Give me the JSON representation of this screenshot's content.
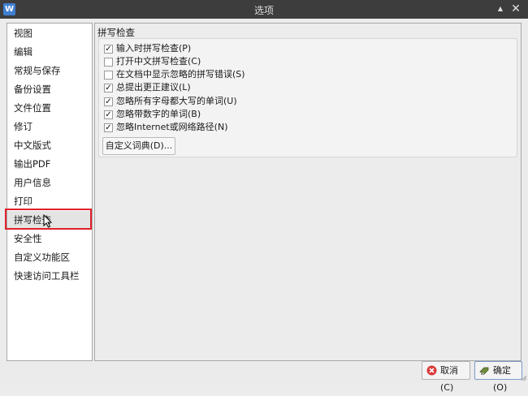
{
  "window": {
    "title": "选项",
    "app_icon_letter": "W"
  },
  "nav": {
    "items": [
      {
        "label": "视图"
      },
      {
        "label": "编辑"
      },
      {
        "label": "常规与保存"
      },
      {
        "label": "备份设置"
      },
      {
        "label": "文件位置"
      },
      {
        "label": "修订"
      },
      {
        "label": "中文版式"
      },
      {
        "label": "输出PDF"
      },
      {
        "label": "用户信息"
      },
      {
        "label": "打印"
      },
      {
        "label": "拼写检查"
      },
      {
        "label": "安全性"
      },
      {
        "label": "自定义功能区"
      },
      {
        "label": "快速访问工具栏"
      }
    ],
    "selected": "拼写检查"
  },
  "panel": {
    "section_title": "拼写检查",
    "options": [
      {
        "label": "输入时拼写检查(P)",
        "checked": true
      },
      {
        "label": "打开中文拼写检查(C)",
        "checked": false
      },
      {
        "label": "在文档中显示忽略的拼写错误(S)",
        "checked": false
      },
      {
        "label": "总提出更正建议(L)",
        "checked": true
      },
      {
        "label": "忽略所有字母都大写的单词(U)",
        "checked": true
      },
      {
        "label": "忽略带数字的单词(B)",
        "checked": true
      },
      {
        "label": "忽略Internet或网络路径(N)",
        "checked": true
      }
    ],
    "dict_button": "自定义词典(D)..."
  },
  "footer": {
    "cancel_label": "取消(C)",
    "ok_label": "确定(O)"
  },
  "colors": {
    "titlebar": "#3d3d3d",
    "selection_outline": "#e0202a",
    "cancel_icon": "#d83a3a",
    "ok_icon": "#6f8a3a"
  }
}
